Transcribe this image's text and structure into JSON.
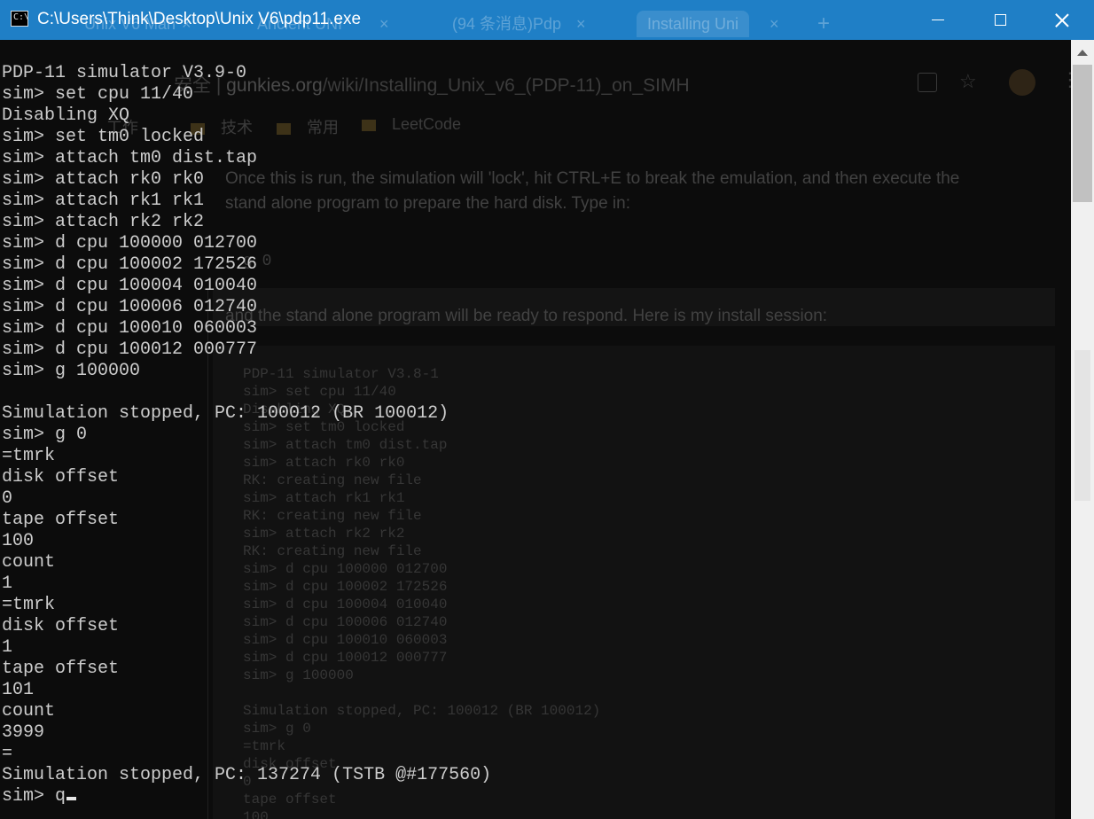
{
  "window": {
    "title": "C:\\Users\\Think\\Desktop\\Unix V6\\pdp11.exe",
    "controls": {
      "minimize": "minimize-button",
      "maximize": "maximize-button",
      "close": "close-button"
    }
  },
  "background_browser": {
    "tabs": [
      {
        "label": "Unix V6 Man",
        "close": "×"
      },
      {
        "label": "Ancient UNI",
        "close": "×"
      },
      {
        "label": "(94 条消息)Pdp",
        "close": "×"
      },
      {
        "label": "Installing Uni",
        "close": "×"
      }
    ],
    "new_tab": "+",
    "address_prefix": "安全 |",
    "address_host": "gunkies.org",
    "address_path": "/wiki/Installing_Unix_v6_(PDP-11)_on_SIMH",
    "bookmarks": [
      "工作",
      "技术",
      "常用",
      "LeetCode"
    ],
    "para1_line1": "Once this is run, the simulation will 'lock', hit CTRL+E to break the emulation, and then execute the",
    "para1_line2": "stand alone program to prepare the hard disk. Type in:",
    "code1": "g 0",
    "para2": "and the stand alone program will be ready to respond. Here is my install session:",
    "session": "PDP-11 simulator V3.8-1\nsim> set cpu 11/40\nDisabling XQ\nsim> set tm0 locked\nsim> attach tm0 dist.tap\nsim> attach rk0 rk0\nRK: creating new file\nsim> attach rk1 rk1\nRK: creating new file\nsim> attach rk2 rk2\nRK: creating new file\nsim> d cpu 100000 012700\nsim> d cpu 100002 172526\nsim> d cpu 100004 010040\nsim> d cpu 100006 012740\nsim> d cpu 100010 060003\nsim> d cpu 100012 000777\nsim> g 100000\n\nSimulation stopped, PC: 100012 (BR 100012)\nsim> g 0\n=tmrk\ndisk offset\n0\ntape offset\n100"
  },
  "terminal": {
    "lines": [
      "PDP-11 simulator V3.9-0",
      "sim> set cpu 11/40",
      "Disabling XQ",
      "sim> set tm0 locked",
      "sim> attach tm0 dist.tap",
      "sim> attach rk0 rk0",
      "sim> attach rk1 rk1",
      "sim> attach rk2 rk2",
      "sim> d cpu 100000 012700",
      "sim> d cpu 100002 172526",
      "sim> d cpu 100004 010040",
      "sim> d cpu 100006 012740",
      "sim> d cpu 100010 060003",
      "sim> d cpu 100012 000777",
      "sim> g 100000",
      "",
      "Simulation stopped, PC: 100012 (BR 100012)",
      "sim> g 0",
      "=tmrk",
      "disk offset",
      "0",
      "tape offset",
      "100",
      "count",
      "1",
      "=tmrk",
      "disk offset",
      "1",
      "tape offset",
      "101",
      "count",
      "3999",
      "=",
      "Simulation stopped, PC: 137274 (TSTB @#177560)"
    ],
    "prompt_line": "sim> q"
  },
  "colors": {
    "titlebar": "#1f7fc6",
    "console_bg": "#0c0c0c",
    "console_fg": "#cccccc",
    "scrollbar_bg": "#f0f0f0",
    "scrollbar_thumb": "#c1c1c1"
  }
}
